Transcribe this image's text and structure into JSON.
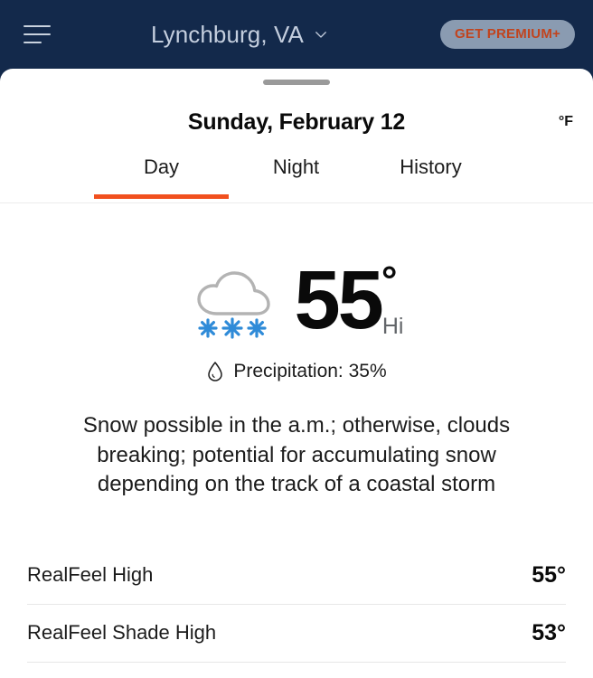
{
  "header": {
    "menu_icon": "hamburger-menu-icon",
    "location": "Lynchburg, VA",
    "location_chevron_icon": "chevron-down-icon",
    "premium_button": "GET PREMIUM+",
    "background_color": "#13294b",
    "premium_bg_color": "#8a9bb1",
    "premium_text_color": "#c1441e"
  },
  "sheet": {
    "drag_handle": "drag-handle",
    "date": "Sunday, February 12",
    "unit": "°F",
    "tabs": [
      {
        "label": "Day",
        "active": true
      },
      {
        "label": "Night",
        "active": false
      },
      {
        "label": "History",
        "active": false
      }
    ],
    "active_tab_color": "#f1501e"
  },
  "current": {
    "weather_icon": "cloud-with-snow-icon",
    "snow_color": "#2f8bd8",
    "cloud_color": "#b3b3b3",
    "temperature": "55",
    "degree": "°",
    "hilo_label": "Hi",
    "precipitation_icon": "water-drop-icon",
    "precipitation_text": "Precipitation: 35%",
    "description": "Snow possible in the a.m.; otherwise, clouds breaking; potential for accumulating snow depending on the track of a coastal storm"
  },
  "details": [
    {
      "label": "RealFeel High",
      "value": "55°"
    },
    {
      "label": "RealFeel Shade High",
      "value": "53°"
    }
  ]
}
